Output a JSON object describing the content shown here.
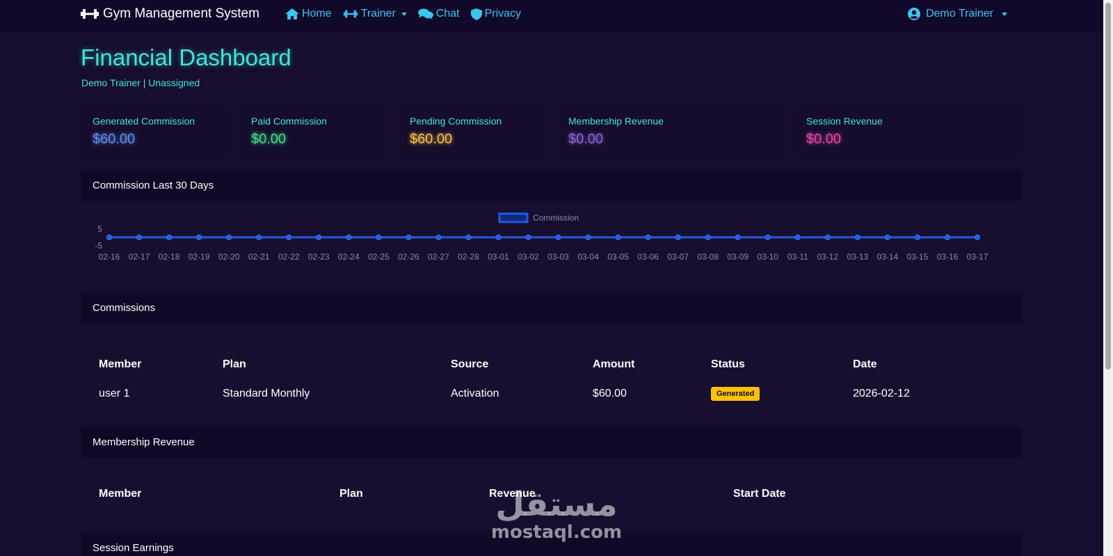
{
  "nav": {
    "brand": "Gym Management System",
    "links": [
      {
        "label": "Home",
        "icon": "home-icon"
      },
      {
        "label": "Trainer",
        "icon": "dumbbell-icon",
        "dropdown": true
      },
      {
        "label": "Chat",
        "icon": "chat-icon"
      },
      {
        "label": "Privacy",
        "icon": "shield-icon"
      }
    ],
    "user": "Demo Trainer"
  },
  "page": {
    "title": "Financial Dashboard",
    "subtitle": "Demo Trainer | Unassigned"
  },
  "stats": [
    {
      "label": "Generated Commission",
      "value": "$60.00",
      "color": "#5b8ee6"
    },
    {
      "label": "Paid Commission",
      "value": "$0.00",
      "color": "#3ddc84"
    },
    {
      "label": "Pending Commission",
      "value": "$60.00",
      "color": "#f5c04a"
    },
    {
      "label": "Membership Revenue",
      "value": "$0.00",
      "color": "#8a63d2"
    },
    {
      "label": "Session Revenue",
      "value": "$0.00",
      "color": "#e048a5"
    }
  ],
  "commission_chart": {
    "header": "Commission Last 30 Days",
    "legend": "Commission"
  },
  "chart_data": {
    "type": "line",
    "title": "",
    "series": [
      {
        "name": "Commission",
        "values": [
          0,
          0,
          0,
          0,
          0,
          0,
          0,
          0,
          0,
          0,
          0,
          0,
          0,
          0,
          0,
          0,
          0,
          0,
          0,
          0,
          0,
          0,
          0,
          0,
          0,
          0,
          0,
          0,
          0,
          0
        ]
      }
    ],
    "x": [
      "02-16",
      "02-17",
      "02-18",
      "02-19",
      "02-20",
      "02-21",
      "02-22",
      "02-23",
      "02-24",
      "02-25",
      "02-26",
      "02-27",
      "02-28",
      "03-01",
      "03-02",
      "03-03",
      "03-04",
      "03-05",
      "03-06",
      "03-07",
      "03-08",
      "03-09",
      "03-10",
      "03-11",
      "03-12",
      "03-13",
      "03-14",
      "03-15",
      "03-16",
      "03-17"
    ],
    "yticks": [
      "5",
      "-5"
    ],
    "ylim": [
      -5,
      5
    ],
    "legend_position": "top-center",
    "color": "#1f5ae0"
  },
  "commissions": {
    "header": "Commissions",
    "columns": [
      "Member",
      "Plan",
      "Source",
      "Amount",
      "Status",
      "Date"
    ],
    "rows": [
      {
        "member": "user 1",
        "plan": "Standard Monthly",
        "source": "Activation",
        "amount": "$60.00",
        "status": "Generated",
        "date": "2026-02-12"
      }
    ]
  },
  "membership_revenue": {
    "header": "Membership Revenue",
    "columns": [
      "Member",
      "Plan",
      "Revenue",
      "Start Date"
    ]
  },
  "session_earnings": {
    "header": "Session Earnings"
  },
  "watermark": {
    "arabic": "مستقل",
    "latin": "mostaql.com"
  }
}
